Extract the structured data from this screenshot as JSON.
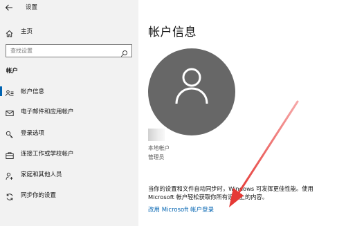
{
  "window": {
    "title": "设置"
  },
  "sidebar": {
    "home_label": "主页",
    "search": {
      "placeholder": "查找设置"
    },
    "section_title": "帐户",
    "items": [
      {
        "label": "帐户信息",
        "icon": "account-info-icon",
        "active": true
      },
      {
        "label": "电子邮件和应用帐户",
        "icon": "mail-icon",
        "active": false
      },
      {
        "label": "登录选项",
        "icon": "key-icon",
        "active": false
      },
      {
        "label": "连接工作或学校帐户",
        "icon": "briefcase-icon",
        "active": false
      },
      {
        "label": "家庭和其他人员",
        "icon": "person-add-icon",
        "active": false
      },
      {
        "label": "同步你的设置",
        "icon": "sync-icon",
        "active": false
      }
    ]
  },
  "main": {
    "title": "帐户信息",
    "account_type": "本地帐户",
    "account_role": "管理员",
    "description_line1": "当你的设置和文件自动同步时，Windows 可发挥更佳性能。使用",
    "description_line2": "Microsoft 帐户轻松获取你所有设备上的内容。",
    "switch_link": "改用 Microsoft 帐户登录"
  },
  "colors": {
    "accent": "#0063b1",
    "sidebar_bg": "#f2f2f2",
    "avatar_bg": "#676767",
    "annotation_arrow": "#e53935"
  }
}
